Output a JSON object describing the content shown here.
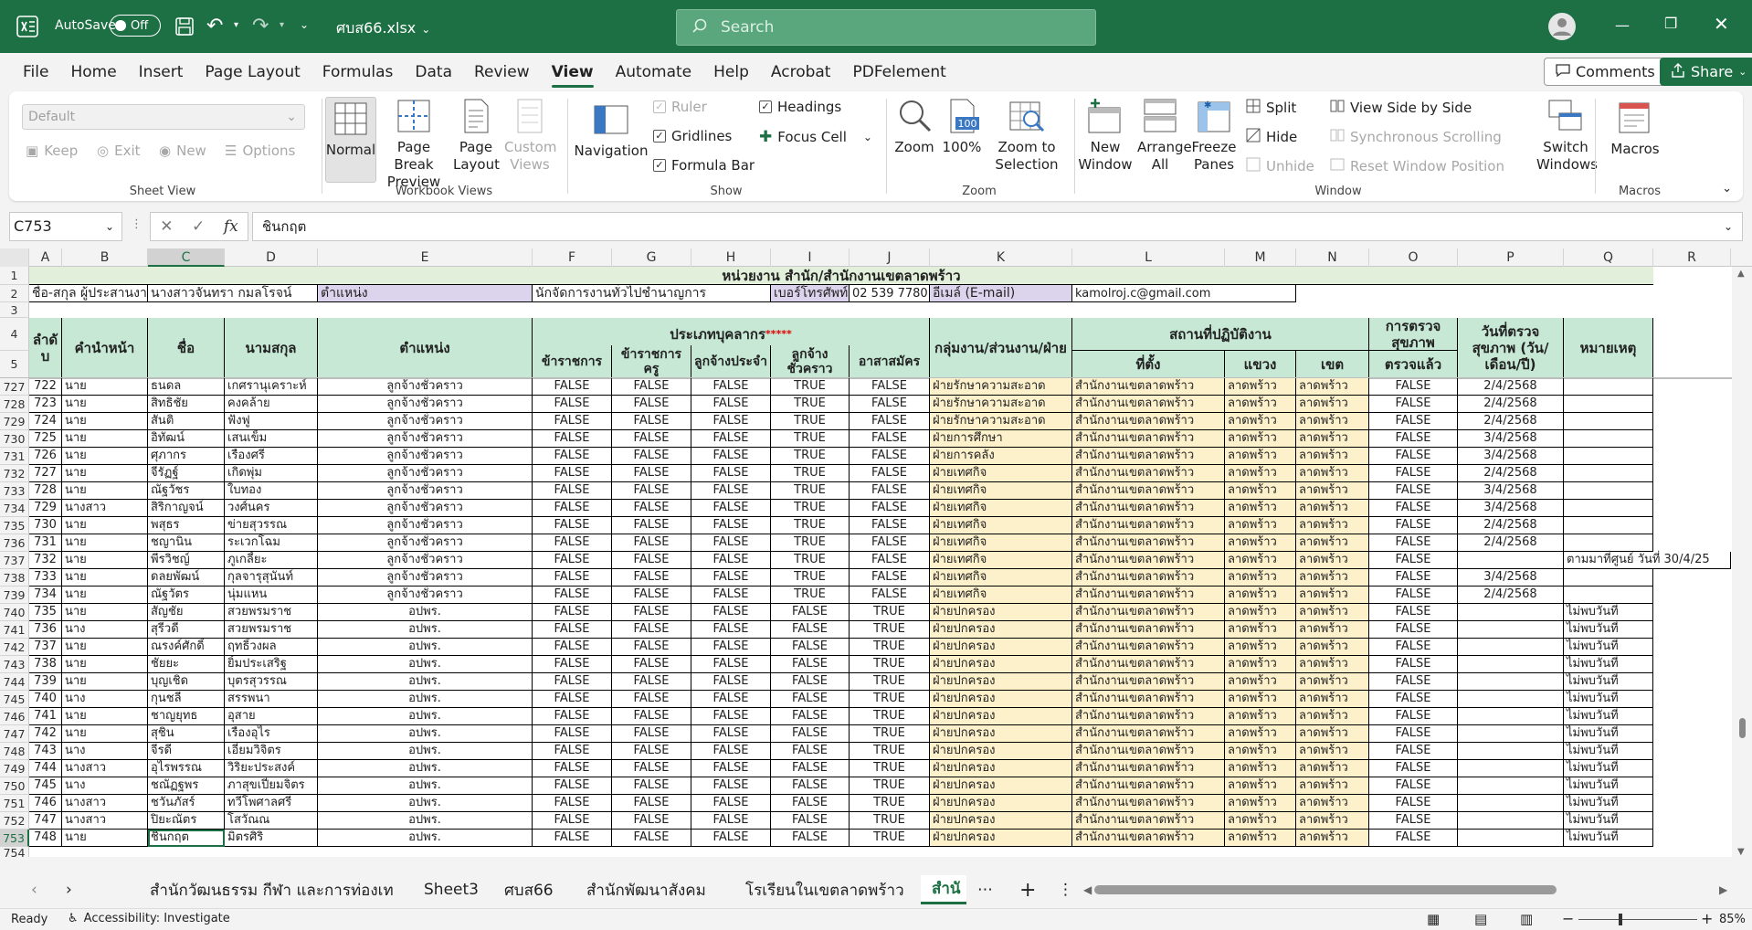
{
  "titlebar": {
    "autosave_label": "AutoSave",
    "autosave_state": "Off",
    "filename": "ศบส66.xlsx",
    "search_placeholder": "Search"
  },
  "menu": [
    "File",
    "Home",
    "Insert",
    "Page Layout",
    "Formulas",
    "Data",
    "Review",
    "View",
    "Automate",
    "Help",
    "Acrobat",
    "PDFelement"
  ],
  "menu_active": "View",
  "comments_label": "Comments",
  "share_label": "Share",
  "ribbon": {
    "sheetview": {
      "dropdown_value": "Default",
      "keep": "Keep",
      "exit": "Exit",
      "new": "New",
      "options": "Options",
      "label": "Sheet View"
    },
    "workbookviews": {
      "normal": "Normal",
      "pagebreak": "Page Break Preview",
      "pagelayout": "Page Layout",
      "custom": "Custom Views",
      "label": "Workbook Views"
    },
    "show": {
      "navigation": "Navigation",
      "ruler": "Ruler",
      "gridlines": "Gridlines",
      "formulabar": "Formula Bar",
      "headings": "Headings",
      "focuscell": "Focus Cell",
      "label": "Show"
    },
    "zoom": {
      "zoom": "Zoom",
      "hundred": "100%",
      "zoomsel": "Zoom to Selection",
      "label": "Zoom"
    },
    "window": {
      "newwindow": "New Window",
      "arrange": "Arrange All",
      "freeze": "Freeze Panes",
      "split": "Split",
      "hide": "Hide",
      "unhide": "Unhide",
      "sidebyside": "View Side by Side",
      "syncscroll": "Synchronous Scrolling",
      "reset": "Reset Window Position",
      "switch": "Switch Windows",
      "label": "Window"
    },
    "macros": {
      "macros": "Macros",
      "label": "Macros"
    }
  },
  "formula": {
    "namebox": "C753",
    "fx": "fx",
    "content": "ชินกฤต"
  },
  "columns": [
    "A",
    "B",
    "C",
    "D",
    "E",
    "F",
    "G",
    "H",
    "I",
    "J",
    "K",
    "L",
    "M",
    "N",
    "O",
    "P",
    "Q",
    "R"
  ],
  "sheet": {
    "title": "หน่วยงาน สำนัก/สำนักงานเขตลาดพร้าว",
    "row2": {
      "a": "ชื่อ-สกุล ผู้ประสานงาน",
      "c": "นางสาวจันทรา กมลโรจน์",
      "e_label": "ตำแหน่ง",
      "f": "นักจัดการงานทั่วไปชำนาญการ",
      "i": "เบอร์โทรศัพท์",
      "j": "02 539 7780",
      "k": "อีเมล์ (E-mail)",
      "l": "kamolroj.c@gmail.com"
    },
    "headers": {
      "a": "ลำดั บ",
      "b": "คำนำหน้า",
      "c": "ชื่อ",
      "d": "นามสกุล",
      "e": "ตำแหน่ง",
      "personnel_type": "ประเภทบุคลากร",
      "personnel_stars": "*****",
      "f": "ข้าราชการ",
      "g": "ข้าราชการครู",
      "h": "ลูกจ้างประจำ",
      "i": "ลูกจ้างชั่วคราว",
      "j": "อาสาสมัคร",
      "k": "กลุ่มงาน/ส่วนงาน/ฝ่าย",
      "workplace": "สถานที่ปฏิบัติงาน",
      "l": "ที่ตั้ง",
      "m": "แขวง",
      "n": "เขต",
      "o_top": "การตรวจสุขภาพ",
      "o": "ตรวจแล้ว",
      "p": "วันที่ตรวจสุขภาพ (วัน/เดือน/ปี)",
      "q": "หมายเหตุ"
    },
    "rows": [
      {
        "r": 727,
        "a": "722",
        "b": "นาย",
        "c": "ธนดล",
        "d": "เกศรานุเคราะห์",
        "e": "ลูกจ้างชั่วคราว",
        "f": "FALSE",
        "g": "FALSE",
        "h": "FALSE",
        "i": "TRUE",
        "j": "FALSE",
        "k": "ฝ่ายรักษาความสะอาด",
        "l": "สำนักงานเขตลาดพร้าว",
        "m": "ลาดพร้าว",
        "n": "ลาดพร้าว",
        "o": "FALSE",
        "p": "2/4/2568",
        "q": ""
      },
      {
        "r": 728,
        "a": "723",
        "b": "นาย",
        "c": "สิทธิชัย",
        "d": "คงคล้าย",
        "e": "ลูกจ้างชั่วคราว",
        "f": "FALSE",
        "g": "FALSE",
        "h": "FALSE",
        "i": "TRUE",
        "j": "FALSE",
        "k": "ฝ่ายรักษาความสะอาด",
        "l": "สำนักงานเขตลาดพร้าว",
        "m": "ลาดพร้าว",
        "n": "ลาดพร้าว",
        "o": "FALSE",
        "p": "2/4/2568",
        "q": ""
      },
      {
        "r": 729,
        "a": "724",
        "b": "นาย",
        "c": "สันติ",
        "d": "ฟังฟู",
        "e": "ลูกจ้างชั่วคราว",
        "f": "FALSE",
        "g": "FALSE",
        "h": "FALSE",
        "i": "TRUE",
        "j": "FALSE",
        "k": "ฝ่ายรักษาความสะอาด",
        "l": "สำนักงานเขตลาดพร้าว",
        "m": "ลาดพร้าว",
        "n": "ลาดพร้าว",
        "o": "FALSE",
        "p": "2/4/2568",
        "q": ""
      },
      {
        "r": 730,
        "a": "725",
        "b": "นาย",
        "c": "อิทัฒน์",
        "d": "เสนเข็ม",
        "e": "ลูกจ้างชั่วคราว",
        "f": "FALSE",
        "g": "FALSE",
        "h": "FALSE",
        "i": "TRUE",
        "j": "FALSE",
        "k": "ฝ่ายการศึกษา",
        "l": "สำนักงานเขตลาดพร้าว",
        "m": "ลาดพร้าว",
        "n": "ลาดพร้าว",
        "o": "FALSE",
        "p": "3/4/2568",
        "q": ""
      },
      {
        "r": 731,
        "a": "726",
        "b": "นาย",
        "c": "ศุภากร",
        "d": "เรืองศรี",
        "e": "ลูกจ้างชั่วคราว",
        "f": "FALSE",
        "g": "FALSE",
        "h": "FALSE",
        "i": "TRUE",
        "j": "FALSE",
        "k": "ฝ่ายการคลัง",
        "l": "สำนักงานเขตลาดพร้าว",
        "m": "ลาดพร้าว",
        "n": "ลาดพร้าว",
        "o": "FALSE",
        "p": "3/4/2568",
        "q": ""
      },
      {
        "r": 732,
        "a": "727",
        "b": "นาย",
        "c": "จีรัฏฐ์",
        "d": "เกิดพุ่ม",
        "e": "ลูกจ้างชั่วคราว",
        "f": "FALSE",
        "g": "FALSE",
        "h": "FALSE",
        "i": "TRUE",
        "j": "FALSE",
        "k": "ฝ่ายเทศกิจ",
        "l": "สำนักงานเขตลาดพร้าว",
        "m": "ลาดพร้าว",
        "n": "ลาดพร้าว",
        "o": "FALSE",
        "p": "2/4/2568",
        "q": ""
      },
      {
        "r": 733,
        "a": "728",
        "b": "นาย",
        "c": "ณัฐวัชร",
        "d": "ใบทอง",
        "e": "ลูกจ้างชั่วคราว",
        "f": "FALSE",
        "g": "FALSE",
        "h": "FALSE",
        "i": "TRUE",
        "j": "FALSE",
        "k": "ฝ่ายเทศกิจ",
        "l": "สำนักงานเขตลาดพร้าว",
        "m": "ลาดพร้าว",
        "n": "ลาดพร้าว",
        "o": "FALSE",
        "p": "3/4/2568",
        "q": ""
      },
      {
        "r": 734,
        "a": "729",
        "b": "นางสาว",
        "c": "สิริกาญจน์",
        "d": "วงศ์นคร",
        "e": "ลูกจ้างชั่วคราว",
        "f": "FALSE",
        "g": "FALSE",
        "h": "FALSE",
        "i": "TRUE",
        "j": "FALSE",
        "k": "ฝ่ายเทศกิจ",
        "l": "สำนักงานเขตลาดพร้าว",
        "m": "ลาดพร้าว",
        "n": "ลาดพร้าว",
        "o": "FALSE",
        "p": "3/4/2568",
        "q": ""
      },
      {
        "r": 735,
        "a": "730",
        "b": "นาย",
        "c": "พสุธร",
        "d": "ข่ายสุวรรณ",
        "e": "ลูกจ้างชั่วคราว",
        "f": "FALSE",
        "g": "FALSE",
        "h": "FALSE",
        "i": "TRUE",
        "j": "FALSE",
        "k": "ฝ่ายเทศกิจ",
        "l": "สำนักงานเขตลาดพร้าว",
        "m": "ลาดพร้าว",
        "n": "ลาดพร้าว",
        "o": "FALSE",
        "p": "2/4/2568",
        "q": ""
      },
      {
        "r": 736,
        "a": "731",
        "b": "นาย",
        "c": "ชญานิน",
        "d": "ระเวกโฉม",
        "e": "ลูกจ้างชั่วคราว",
        "f": "FALSE",
        "g": "FALSE",
        "h": "FALSE",
        "i": "TRUE",
        "j": "FALSE",
        "k": "ฝ่ายเทศกิจ",
        "l": "สำนักงานเขตลาดพร้าว",
        "m": "ลาดพร้าว",
        "n": "ลาดพร้าว",
        "o": "FALSE",
        "p": "2/4/2568",
        "q": ""
      },
      {
        "r": 737,
        "a": "732",
        "b": "นาย",
        "c": "พีรวิชญ์",
        "d": "ภูเกลี้ยะ",
        "e": "ลูกจ้างชั่วคราว",
        "f": "FALSE",
        "g": "FALSE",
        "h": "FALSE",
        "i": "TRUE",
        "j": "FALSE",
        "k": "ฝ่ายเทศกิจ",
        "l": "สำนักงานเขตลาดพร้าว",
        "m": "ลาดพร้าว",
        "n": "ลาดพร้าว",
        "o": "FALSE",
        "p": "",
        "q": "ตามมาที่ศูนย์ วันที่ 30/4/25"
      },
      {
        "r": 738,
        "a": "733",
        "b": "นาย",
        "c": "ดลยพัฒน์",
        "d": "กุลจารุสุนันท์",
        "e": "ลูกจ้างชั่วคราว",
        "f": "FALSE",
        "g": "FALSE",
        "h": "FALSE",
        "i": "TRUE",
        "j": "FALSE",
        "k": "ฝ่ายเทศกิจ",
        "l": "สำนักงานเขตลาดพร้าว",
        "m": "ลาดพร้าว",
        "n": "ลาดพร้าว",
        "o": "FALSE",
        "p": "3/4/2568",
        "q": ""
      },
      {
        "r": 739,
        "a": "734",
        "b": "นาย",
        "c": "ณัฐวัตร",
        "d": "นุ่มแหน",
        "e": "ลูกจ้างชั่วคราว",
        "f": "FALSE",
        "g": "FALSE",
        "h": "FALSE",
        "i": "TRUE",
        "j": "FALSE",
        "k": "ฝ่ายเทศกิจ",
        "l": "สำนักงานเขตลาดพร้าว",
        "m": "ลาดพร้าว",
        "n": "ลาดพร้าว",
        "o": "FALSE",
        "p": "2/4/2568",
        "q": ""
      },
      {
        "r": 740,
        "a": "735",
        "b": "นาย",
        "c": "สัญชัย",
        "d": "สวยพรมราช",
        "e": "อปพร.",
        "f": "FALSE",
        "g": "FALSE",
        "h": "FALSE",
        "i": "FALSE",
        "j": "TRUE",
        "k": "ฝ่ายปกครอง",
        "l": "สำนักงานเขตลาดพร้าว",
        "m": "ลาดพร้าว",
        "n": "ลาดพร้าว",
        "o": "FALSE",
        "p": "",
        "q": "ไม่พบวันที่"
      },
      {
        "r": 741,
        "a": "736",
        "b": "นาง",
        "c": "สุรีวดี",
        "d": "สวยพรมราช",
        "e": "อปพร.",
        "f": "FALSE",
        "g": "FALSE",
        "h": "FALSE",
        "i": "FALSE",
        "j": "TRUE",
        "k": "ฝ่ายปกครอง",
        "l": "สำนักงานเขตลาดพร้าว",
        "m": "ลาดพร้าว",
        "n": "ลาดพร้าว",
        "o": "FALSE",
        "p": "",
        "q": "ไม่พบวันที่"
      },
      {
        "r": 742,
        "a": "737",
        "b": "นาย",
        "c": "ณรงค์ศักดิ์",
        "d": "ฤทธิ์วงผล",
        "e": "อปพร.",
        "f": "FALSE",
        "g": "FALSE",
        "h": "FALSE",
        "i": "FALSE",
        "j": "TRUE",
        "k": "ฝ่ายปกครอง",
        "l": "สำนักงานเขตลาดพร้าว",
        "m": "ลาดพร้าว",
        "n": "ลาดพร้าว",
        "o": "FALSE",
        "p": "",
        "q": "ไม่พบวันที่"
      },
      {
        "r": 743,
        "a": "738",
        "b": "นาย",
        "c": "ชัยยะ",
        "d": "ยิ้มประเสริฐ",
        "e": "อปพร.",
        "f": "FALSE",
        "g": "FALSE",
        "h": "FALSE",
        "i": "FALSE",
        "j": "TRUE",
        "k": "ฝ่ายปกครอง",
        "l": "สำนักงานเขตลาดพร้าว",
        "m": "ลาดพร้าว",
        "n": "ลาดพร้าว",
        "o": "FALSE",
        "p": "",
        "q": "ไม่พบวันที่"
      },
      {
        "r": 744,
        "a": "739",
        "b": "นาย",
        "c": "บุญเชิด",
        "d": "บุตรสุวรรณ",
        "e": "อปพร.",
        "f": "FALSE",
        "g": "FALSE",
        "h": "FALSE",
        "i": "FALSE",
        "j": "TRUE",
        "k": "ฝ่ายปกครอง",
        "l": "สำนักงานเขตลาดพร้าว",
        "m": "ลาดพร้าว",
        "n": "ลาดพร้าว",
        "o": "FALSE",
        "p": "",
        "q": "ไม่พบวันที่"
      },
      {
        "r": 745,
        "a": "740",
        "b": "นาง",
        "c": "กุนชลี",
        "d": "สรรพนา",
        "e": "อปพร.",
        "f": "FALSE",
        "g": "FALSE",
        "h": "FALSE",
        "i": "FALSE",
        "j": "TRUE",
        "k": "ฝ่ายปกครอง",
        "l": "สำนักงานเขตลาดพร้าว",
        "m": "ลาดพร้าว",
        "n": "ลาดพร้าว",
        "o": "FALSE",
        "p": "",
        "q": "ไม่พบวันที่"
      },
      {
        "r": 746,
        "a": "741",
        "b": "นาย",
        "c": "ชาญยุทธ",
        "d": "อุสาย",
        "e": "อปพร.",
        "f": "FALSE",
        "g": "FALSE",
        "h": "FALSE",
        "i": "FALSE",
        "j": "TRUE",
        "k": "ฝ่ายปกครอง",
        "l": "สำนักงานเขตลาดพร้าว",
        "m": "ลาดพร้าว",
        "n": "ลาดพร้าว",
        "o": "FALSE",
        "p": "",
        "q": "ไม่พบวันที่"
      },
      {
        "r": 747,
        "a": "742",
        "b": "นาย",
        "c": "สุชิน",
        "d": "เรืองอุไร",
        "e": "อปพร.",
        "f": "FALSE",
        "g": "FALSE",
        "h": "FALSE",
        "i": "FALSE",
        "j": "TRUE",
        "k": "ฝ่ายปกครอง",
        "l": "สำนักงานเขตลาดพร้าว",
        "m": "ลาดพร้าว",
        "n": "ลาดพร้าว",
        "o": "FALSE",
        "p": "",
        "q": "ไม่พบวันที่"
      },
      {
        "r": 748,
        "a": "743",
        "b": "นาง",
        "c": "จีรดี",
        "d": "เอี่ยมวิจิตร",
        "e": "อปพร.",
        "f": "FALSE",
        "g": "FALSE",
        "h": "FALSE",
        "i": "FALSE",
        "j": "TRUE",
        "k": "ฝ่ายปกครอง",
        "l": "สำนักงานเขตลาดพร้าว",
        "m": "ลาดพร้าว",
        "n": "ลาดพร้าว",
        "o": "FALSE",
        "p": "",
        "q": "ไม่พบวันที่"
      },
      {
        "r": 749,
        "a": "744",
        "b": "นางสาว",
        "c": "อุไรพรรณ",
        "d": "วิริยะประสงค์",
        "e": "อปพร.",
        "f": "FALSE",
        "g": "FALSE",
        "h": "FALSE",
        "i": "FALSE",
        "j": "TRUE",
        "k": "ฝ่ายปกครอง",
        "l": "สำนักงานเขตลาดพร้าว",
        "m": "ลาดพร้าว",
        "n": "ลาดพร้าว",
        "o": "FALSE",
        "p": "",
        "q": "ไม่พบวันที่"
      },
      {
        "r": 750,
        "a": "745",
        "b": "นาง",
        "c": "ชณัฏฐพร",
        "d": "ภาสุขเปี่ยมจิตร",
        "e": "อปพร.",
        "f": "FALSE",
        "g": "FALSE",
        "h": "FALSE",
        "i": "FALSE",
        "j": "TRUE",
        "k": "ฝ่ายปกครอง",
        "l": "สำนักงานเขตลาดพร้าว",
        "m": "ลาดพร้าว",
        "n": "ลาดพร้าว",
        "o": "FALSE",
        "p": "",
        "q": "ไม่พบวันที่"
      },
      {
        "r": 751,
        "a": "746",
        "b": "นางสาว",
        "c": "ชวันภัสร์",
        "d": "ทวีโพศาลศรี",
        "e": "อปพร.",
        "f": "FALSE",
        "g": "FALSE",
        "h": "FALSE",
        "i": "FALSE",
        "j": "TRUE",
        "k": "ฝ่ายปกครอง",
        "l": "สำนักงานเขตลาดพร้าว",
        "m": "ลาดพร้าว",
        "n": "ลาดพร้าว",
        "o": "FALSE",
        "p": "",
        "q": "ไม่พบวันที่"
      },
      {
        "r": 752,
        "a": "747",
        "b": "นางสาว",
        "c": "ปิยะณัตร",
        "d": "โสวัณณ",
        "e": "อปพร.",
        "f": "FALSE",
        "g": "FALSE",
        "h": "FALSE",
        "i": "FALSE",
        "j": "TRUE",
        "k": "ฝ่ายปกครอง",
        "l": "สำนักงานเขตลาดพร้าว",
        "m": "ลาดพร้าว",
        "n": "ลาดพร้าว",
        "o": "FALSE",
        "p": "",
        "q": "ไม่พบวันที่"
      },
      {
        "r": 753,
        "a": "748",
        "b": "นาย",
        "c": "ชินกฤต",
        "d": "มิตรศิริ",
        "e": "อปพร.",
        "f": "FALSE",
        "g": "FALSE",
        "h": "FALSE",
        "i": "FALSE",
        "j": "TRUE",
        "k": "ฝ่ายปกครอง",
        "l": "สำนักงานเขตลาดพร้าว",
        "m": "ลาดพร้าว",
        "n": "ลาดพร้าว",
        "o": "FALSE",
        "p": "",
        "q": "ไม่พบวันที่"
      }
    ],
    "last_row": "754"
  },
  "tabs": [
    "สำนักวัฒนธรรม กีฬา และการท่องเท",
    "Sheet3",
    "ศบส66",
    "สำนักพัฒนาสังคม",
    "โรเรียนในเขตลาดพร้าว",
    "สำนั"
  ],
  "status": {
    "ready": "Ready",
    "accessibility": "Accessibility: Investigate",
    "zoom": "85%"
  },
  "colors": {
    "excel_green": "#1d7044",
    "header_green": "#c6e8d5",
    "workplace_yellow": "#fdf1cc",
    "lavender": "#dcd3ec"
  }
}
